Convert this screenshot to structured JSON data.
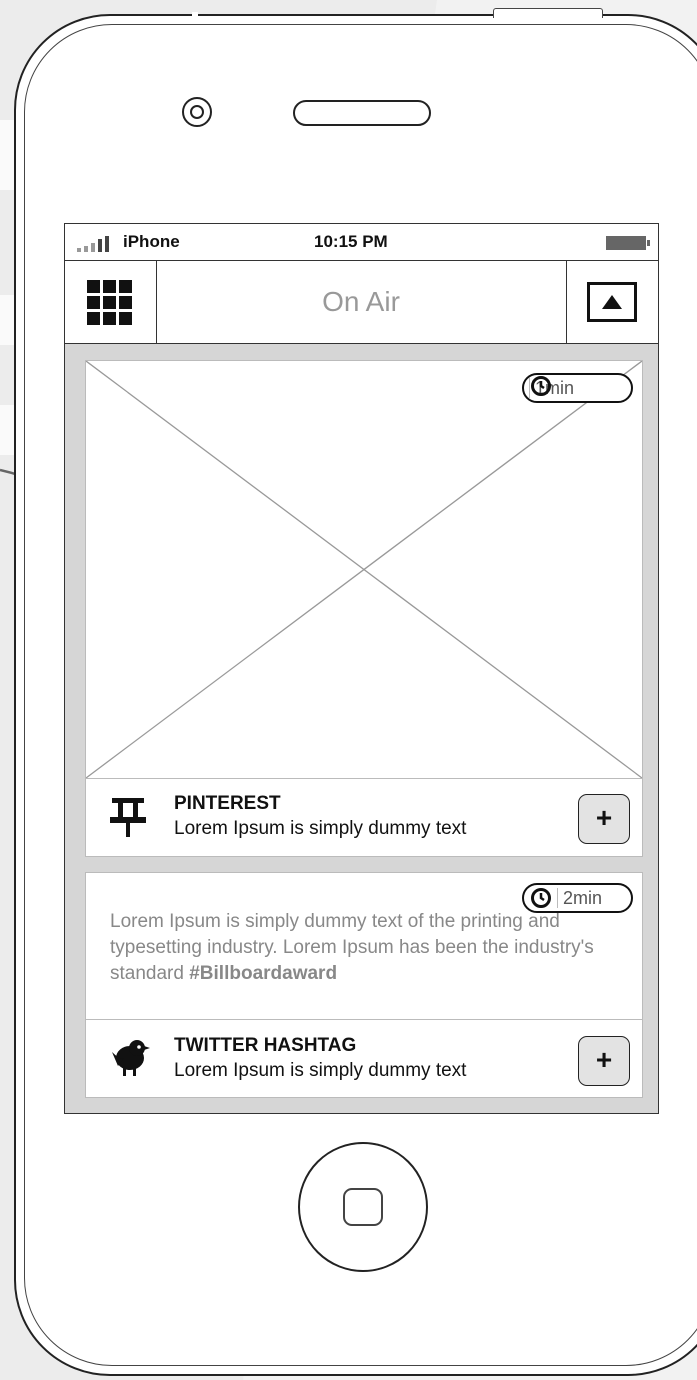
{
  "status_bar": {
    "carrier": "iPhone",
    "time": "10:15 PM"
  },
  "nav": {
    "title": "On Air",
    "left_icon": "grid-menu-icon",
    "right_icon": "upload-tray-icon"
  },
  "cards": [
    {
      "badge": {
        "icon": "clock-icon",
        "text": "1min"
      },
      "media": "image-placeholder",
      "source": {
        "icon": "pin-icon",
        "title": "PINTEREST",
        "subtitle": "Lorem Ipsum is simply dummy text"
      },
      "action_label": "+"
    },
    {
      "badge": {
        "icon": "clock-icon",
        "text": "2min"
      },
      "body_text": "Lorem Ipsum is simply dummy text of the printing and typesetting industry. Lorem Ipsum has been the industry's standard ",
      "hashtag": "#Billboardaward",
      "source": {
        "icon": "bird-icon",
        "title": "TWITTER HASHTAG",
        "subtitle": "Lorem Ipsum is simply dummy text"
      },
      "action_label": "+"
    }
  ],
  "colors": {
    "content_bg": "#d6d6d6",
    "nav_title": "#999999",
    "muted_text": "#888888",
    "button_bg": "#e3e3e3"
  }
}
